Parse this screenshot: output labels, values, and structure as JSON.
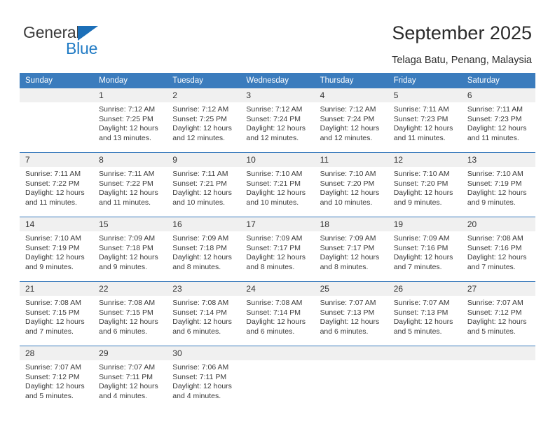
{
  "brand": {
    "name_part1": "General",
    "name_part2": "Blue",
    "triangle_color": "#1c6fb8",
    "blue_color": "#1f7ac4"
  },
  "header": {
    "title": "September 2025",
    "subtitle": "Telaga Batu, Penang, Malaysia"
  },
  "theme": {
    "header_bg": "#3b7cbd",
    "daynum_bg": "#f0f0f0",
    "separator": "#3b7cbd"
  },
  "calendar": {
    "weekday_headers": [
      "Sunday",
      "Monday",
      "Tuesday",
      "Wednesday",
      "Thursday",
      "Friday",
      "Saturday"
    ],
    "labels": {
      "sunrise": "Sunrise:",
      "sunset": "Sunset:",
      "daylight": "Daylight:"
    },
    "weeks": [
      {
        "days": [
          {
            "num": "",
            "sunrise": "",
            "sunset": "",
            "daylight_line1": "",
            "daylight_line2": ""
          },
          {
            "num": "1",
            "sunrise": "Sunrise: 7:12 AM",
            "sunset": "Sunset: 7:25 PM",
            "daylight_line1": "Daylight: 12 hours",
            "daylight_line2": "and 13 minutes."
          },
          {
            "num": "2",
            "sunrise": "Sunrise: 7:12 AM",
            "sunset": "Sunset: 7:25 PM",
            "daylight_line1": "Daylight: 12 hours",
            "daylight_line2": "and 12 minutes."
          },
          {
            "num": "3",
            "sunrise": "Sunrise: 7:12 AM",
            "sunset": "Sunset: 7:24 PM",
            "daylight_line1": "Daylight: 12 hours",
            "daylight_line2": "and 12 minutes."
          },
          {
            "num": "4",
            "sunrise": "Sunrise: 7:12 AM",
            "sunset": "Sunset: 7:24 PM",
            "daylight_line1": "Daylight: 12 hours",
            "daylight_line2": "and 12 minutes."
          },
          {
            "num": "5",
            "sunrise": "Sunrise: 7:11 AM",
            "sunset": "Sunset: 7:23 PM",
            "daylight_line1": "Daylight: 12 hours",
            "daylight_line2": "and 11 minutes."
          },
          {
            "num": "6",
            "sunrise": "Sunrise: 7:11 AM",
            "sunset": "Sunset: 7:23 PM",
            "daylight_line1": "Daylight: 12 hours",
            "daylight_line2": "and 11 minutes."
          }
        ]
      },
      {
        "days": [
          {
            "num": "7",
            "sunrise": "Sunrise: 7:11 AM",
            "sunset": "Sunset: 7:22 PM",
            "daylight_line1": "Daylight: 12 hours",
            "daylight_line2": "and 11 minutes."
          },
          {
            "num": "8",
            "sunrise": "Sunrise: 7:11 AM",
            "sunset": "Sunset: 7:22 PM",
            "daylight_line1": "Daylight: 12 hours",
            "daylight_line2": "and 11 minutes."
          },
          {
            "num": "9",
            "sunrise": "Sunrise: 7:11 AM",
            "sunset": "Sunset: 7:21 PM",
            "daylight_line1": "Daylight: 12 hours",
            "daylight_line2": "and 10 minutes."
          },
          {
            "num": "10",
            "sunrise": "Sunrise: 7:10 AM",
            "sunset": "Sunset: 7:21 PM",
            "daylight_line1": "Daylight: 12 hours",
            "daylight_line2": "and 10 minutes."
          },
          {
            "num": "11",
            "sunrise": "Sunrise: 7:10 AM",
            "sunset": "Sunset: 7:20 PM",
            "daylight_line1": "Daylight: 12 hours",
            "daylight_line2": "and 10 minutes."
          },
          {
            "num": "12",
            "sunrise": "Sunrise: 7:10 AM",
            "sunset": "Sunset: 7:20 PM",
            "daylight_line1": "Daylight: 12 hours",
            "daylight_line2": "and 9 minutes."
          },
          {
            "num": "13",
            "sunrise": "Sunrise: 7:10 AM",
            "sunset": "Sunset: 7:19 PM",
            "daylight_line1": "Daylight: 12 hours",
            "daylight_line2": "and 9 minutes."
          }
        ]
      },
      {
        "days": [
          {
            "num": "14",
            "sunrise": "Sunrise: 7:10 AM",
            "sunset": "Sunset: 7:19 PM",
            "daylight_line1": "Daylight: 12 hours",
            "daylight_line2": "and 9 minutes."
          },
          {
            "num": "15",
            "sunrise": "Sunrise: 7:09 AM",
            "sunset": "Sunset: 7:18 PM",
            "daylight_line1": "Daylight: 12 hours",
            "daylight_line2": "and 9 minutes."
          },
          {
            "num": "16",
            "sunrise": "Sunrise: 7:09 AM",
            "sunset": "Sunset: 7:18 PM",
            "daylight_line1": "Daylight: 12 hours",
            "daylight_line2": "and 8 minutes."
          },
          {
            "num": "17",
            "sunrise": "Sunrise: 7:09 AM",
            "sunset": "Sunset: 7:17 PM",
            "daylight_line1": "Daylight: 12 hours",
            "daylight_line2": "and 8 minutes."
          },
          {
            "num": "18",
            "sunrise": "Sunrise: 7:09 AM",
            "sunset": "Sunset: 7:17 PM",
            "daylight_line1": "Daylight: 12 hours",
            "daylight_line2": "and 8 minutes."
          },
          {
            "num": "19",
            "sunrise": "Sunrise: 7:09 AM",
            "sunset": "Sunset: 7:16 PM",
            "daylight_line1": "Daylight: 12 hours",
            "daylight_line2": "and 7 minutes."
          },
          {
            "num": "20",
            "sunrise": "Sunrise: 7:08 AM",
            "sunset": "Sunset: 7:16 PM",
            "daylight_line1": "Daylight: 12 hours",
            "daylight_line2": "and 7 minutes."
          }
        ]
      },
      {
        "days": [
          {
            "num": "21",
            "sunrise": "Sunrise: 7:08 AM",
            "sunset": "Sunset: 7:15 PM",
            "daylight_line1": "Daylight: 12 hours",
            "daylight_line2": "and 7 minutes."
          },
          {
            "num": "22",
            "sunrise": "Sunrise: 7:08 AM",
            "sunset": "Sunset: 7:15 PM",
            "daylight_line1": "Daylight: 12 hours",
            "daylight_line2": "and 6 minutes."
          },
          {
            "num": "23",
            "sunrise": "Sunrise: 7:08 AM",
            "sunset": "Sunset: 7:14 PM",
            "daylight_line1": "Daylight: 12 hours",
            "daylight_line2": "and 6 minutes."
          },
          {
            "num": "24",
            "sunrise": "Sunrise: 7:08 AM",
            "sunset": "Sunset: 7:14 PM",
            "daylight_line1": "Daylight: 12 hours",
            "daylight_line2": "and 6 minutes."
          },
          {
            "num": "25",
            "sunrise": "Sunrise: 7:07 AM",
            "sunset": "Sunset: 7:13 PM",
            "daylight_line1": "Daylight: 12 hours",
            "daylight_line2": "and 6 minutes."
          },
          {
            "num": "26",
            "sunrise": "Sunrise: 7:07 AM",
            "sunset": "Sunset: 7:13 PM",
            "daylight_line1": "Daylight: 12 hours",
            "daylight_line2": "and 5 minutes."
          },
          {
            "num": "27",
            "sunrise": "Sunrise: 7:07 AM",
            "sunset": "Sunset: 7:12 PM",
            "daylight_line1": "Daylight: 12 hours",
            "daylight_line2": "and 5 minutes."
          }
        ]
      },
      {
        "days": [
          {
            "num": "28",
            "sunrise": "Sunrise: 7:07 AM",
            "sunset": "Sunset: 7:12 PM",
            "daylight_line1": "Daylight: 12 hours",
            "daylight_line2": "and 5 minutes."
          },
          {
            "num": "29",
            "sunrise": "Sunrise: 7:07 AM",
            "sunset": "Sunset: 7:11 PM",
            "daylight_line1": "Daylight: 12 hours",
            "daylight_line2": "and 4 minutes."
          },
          {
            "num": "30",
            "sunrise": "Sunrise: 7:06 AM",
            "sunset": "Sunset: 7:11 PM",
            "daylight_line1": "Daylight: 12 hours",
            "daylight_line2": "and 4 minutes."
          },
          {
            "num": "",
            "sunrise": "",
            "sunset": "",
            "daylight_line1": "",
            "daylight_line2": ""
          },
          {
            "num": "",
            "sunrise": "",
            "sunset": "",
            "daylight_line1": "",
            "daylight_line2": ""
          },
          {
            "num": "",
            "sunrise": "",
            "sunset": "",
            "daylight_line1": "",
            "daylight_line2": ""
          },
          {
            "num": "",
            "sunrise": "",
            "sunset": "",
            "daylight_line1": "",
            "daylight_line2": ""
          }
        ]
      }
    ]
  }
}
